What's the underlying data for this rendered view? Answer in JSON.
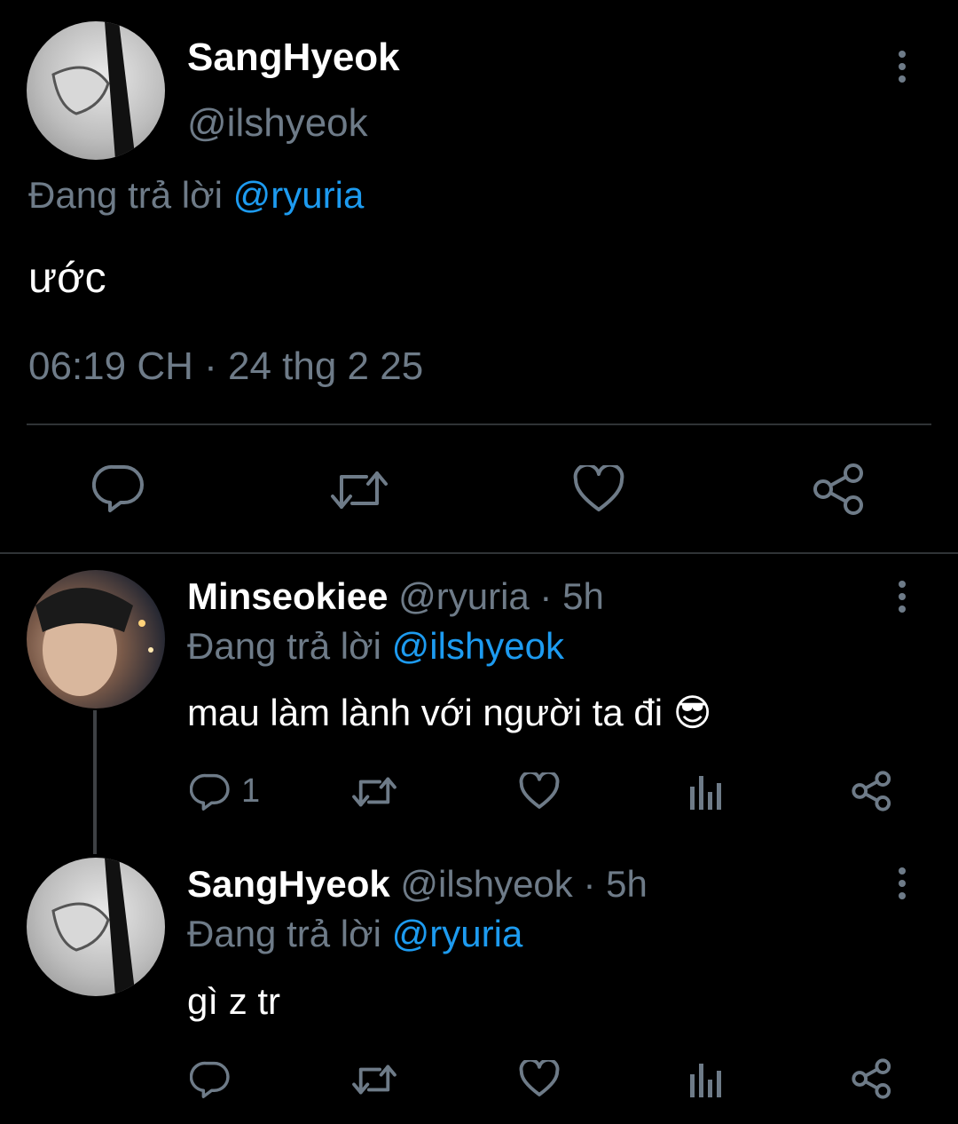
{
  "main_tweet": {
    "author_name": "SangHyeok",
    "author_handle": "@ilshyeok",
    "replying_prefix": "Đang trả lời",
    "replying_to": "@ryuria",
    "text": "ước",
    "timestamp": "06:19 CH · 24 thg 2 25"
  },
  "replies": [
    {
      "author_name": "Minseokiee",
      "handle_time": "@ryuria · 5h",
      "replying_prefix": "Đang trả lời",
      "replying_to": "@ilshyeok",
      "text": "mau làm lành với người ta đi",
      "emoji": "😎",
      "reply_count": "1"
    },
    {
      "author_name": "SangHyeok",
      "handle_time": "@ilshyeok · 5h",
      "replying_prefix": "Đang trả lời",
      "replying_to": "@ryuria",
      "text": "gì z tr",
      "reply_count": ""
    }
  ],
  "icons": {
    "more": "more-vertical-icon",
    "reply": "reply-bubble-icon",
    "retweet": "retweet-icon",
    "like": "heart-icon",
    "views": "analytics-bars-icon",
    "share": "share-icon"
  },
  "colors": {
    "background": "#000000",
    "text": "#e7e9ea",
    "muted": "#6e7b88",
    "link": "#1d9bf0",
    "divider": "#2f3336"
  }
}
